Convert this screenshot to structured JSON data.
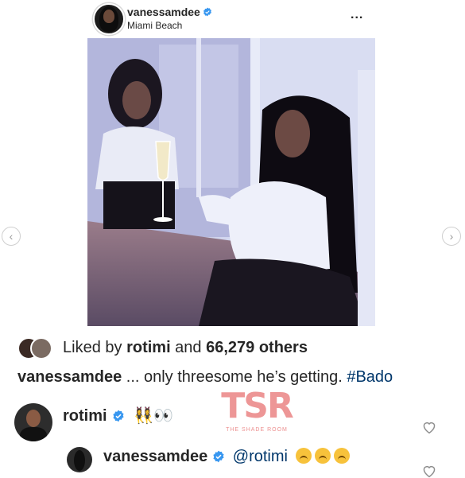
{
  "post": {
    "username": "vanessamdee",
    "location": "Miami Beach",
    "more_label": "...",
    "likes": {
      "prefix": "Liked by ",
      "user": "rotimi",
      "middle": " and ",
      "count": "66,279 others"
    },
    "caption": {
      "username": "vanessamdee",
      "text": " ... only threesome he’s getting. ",
      "hashtag": "#Bado"
    }
  },
  "comments": [
    {
      "username": "rotimi",
      "emoji": "👯‍♀️👀"
    }
  ],
  "reply": {
    "username": "vanessamdee",
    "mention": "@rotimi"
  },
  "watermark": {
    "brand": "TSR",
    "tagline": "THE SHADE ROOM"
  },
  "colors": {
    "verified": "#3897f0",
    "link": "#00376b",
    "watermark": "#e66a6a"
  }
}
